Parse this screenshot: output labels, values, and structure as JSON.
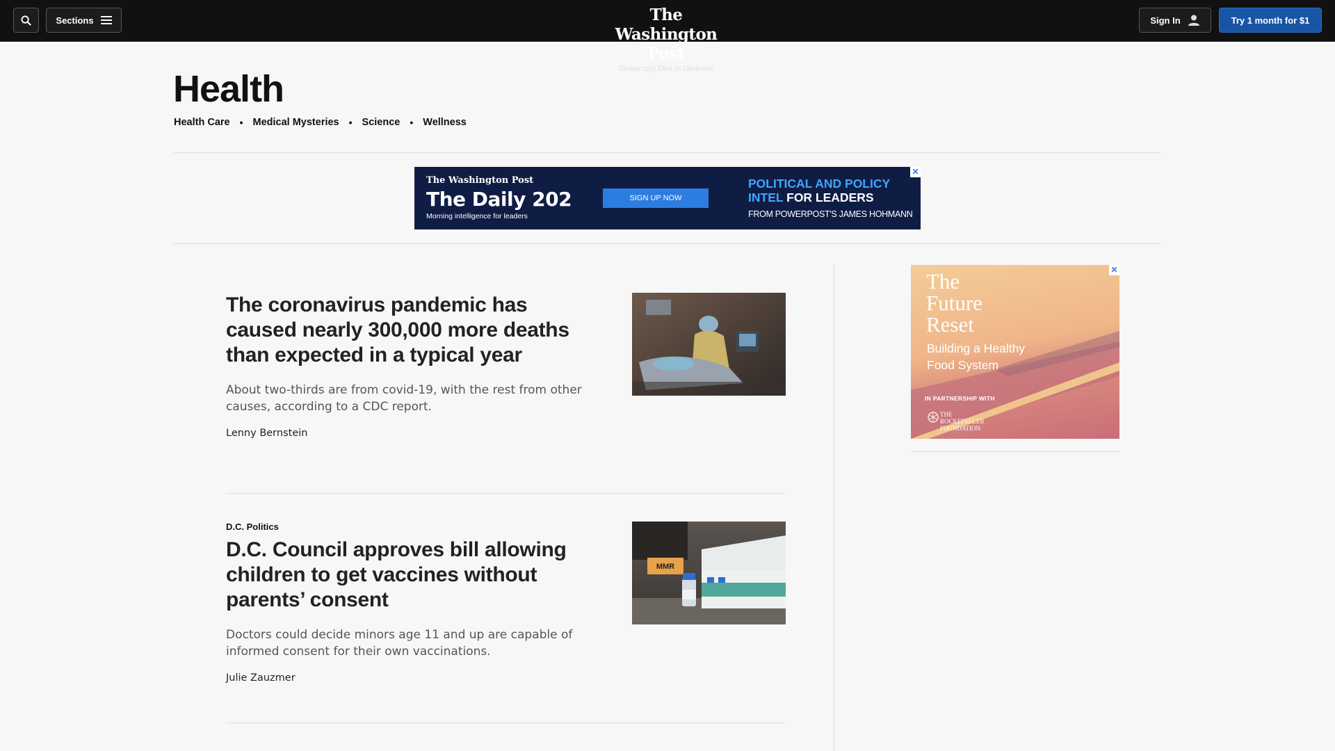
{
  "header": {
    "sections_label": "Sections",
    "logo_name": "The Washington Post",
    "logo_tagline": "Democracy Dies in Darkness",
    "signin_label": "Sign In",
    "subscribe_label": "Try 1 month for $1"
  },
  "page": {
    "title": "Health",
    "subnav": [
      "Health Care",
      "Medical Mysteries",
      "Science",
      "Wellness"
    ]
  },
  "banner_ad": {
    "brand": "The Washington Post",
    "title": "The Daily 202",
    "subtitle": "Morning intelligence for leaders",
    "cta": "SIGN UP NOW",
    "headline_accent": "POLITICAL AND POLICY",
    "headline_accent2": "INTEL",
    "headline_rest": "FOR LEADERS",
    "from": "FROM POWERPOST'S JAMES HOHMANN",
    "close": "✕"
  },
  "stories": [
    {
      "kicker": "",
      "headline": "The coronavirus pandemic has caused nearly 300,000 more deaths than expected in a typical year",
      "blurb": "About two-thirds are from covid-19, with the rest from other causes, according to a CDC report.",
      "byline": "Lenny Bernstein"
    },
    {
      "kicker": "D.C. Politics",
      "headline": "D.C. Council approves bill allowing children to get vaccines without parents’ consent",
      "blurb": "Doctors could decide minors age 11 and up are capable of informed consent for their own vaccinations.",
      "byline": "Julie Zauzmer"
    }
  ],
  "side_ad": {
    "title_lines": [
      "The",
      "Future",
      "Reset"
    ],
    "subtitle_lines": [
      "Building a Healthy",
      "Food System"
    ],
    "partnership": "IN PARTNERSHIP WITH",
    "org_lines": [
      "THE",
      "ROCKEFELLER",
      "FOUNDATION"
    ],
    "close": "✕"
  },
  "thumb_labels": {
    "mmr": "MMR"
  },
  "colors": {
    "topbar": "#111111",
    "subscribe": "#1955a5",
    "banner_bg": "#0f1d45",
    "banner_accent": "#3fa6ff"
  }
}
